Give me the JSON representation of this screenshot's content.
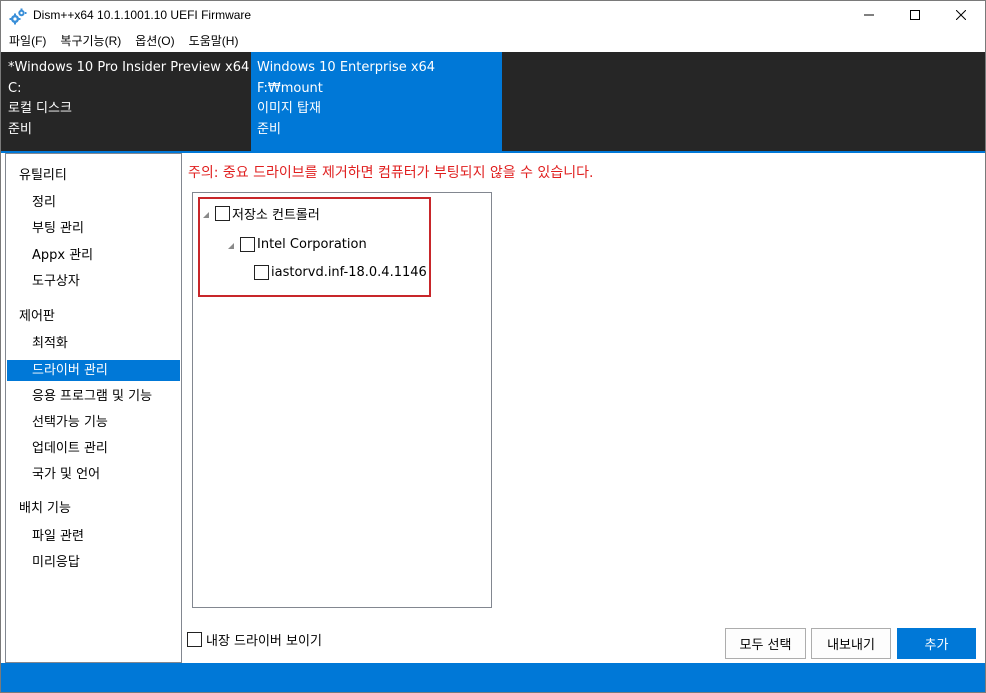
{
  "window": {
    "title": "Dism++x64 10.1.1001.10 UEFI Firmware",
    "icon": "gears-icon",
    "controls": [
      "minimize-icon",
      "maximize-icon",
      "close-icon"
    ]
  },
  "menu": {
    "items": [
      "파일(F)",
      "복구기능(R)",
      "옵션(O)",
      "도움말(H)"
    ]
  },
  "images": [
    {
      "name": "*Windows 10 Pro Insider Preview x64",
      "path": "C:",
      "type": "로컬 디스크",
      "status": "준비"
    },
    {
      "name": "Windows 10 Enterprise x64",
      "path": "F:₩mount",
      "type": "이미지 탑재",
      "status": "준비"
    }
  ],
  "sidebar": {
    "groups": [
      {
        "label": "유틸리티",
        "items": [
          "정리",
          "부팅 관리",
          "Appx 관리",
          "도구상자"
        ]
      },
      {
        "label": "제어판",
        "items": [
          "최적화",
          "드라이버 관리",
          "응용 프로그램 및 기능",
          "선택가능 기능",
          "업데이트 관리",
          "국가 및 언어"
        ]
      },
      {
        "label": "배치 기능",
        "items": [
          "파일 관련",
          "미리응답"
        ]
      }
    ],
    "selected": "드라이버 관리"
  },
  "main": {
    "warning": "주의: 중요 드라이브를 제거하면 컴퓨터가 부팅되지 않을 수 있습니다.",
    "tree": {
      "root": "저장소 컨트롤러",
      "vendor": "Intel Corporation",
      "driver": "iastorvd.inf-18.0.4.1146"
    },
    "show_builtin_label": "내장 드라이버 보이기",
    "buttons": {
      "select_all": "모두 선택",
      "export": "내보내기",
      "add": "추가"
    }
  },
  "colors": {
    "accent": "#0078d7",
    "warning": "#e02020",
    "highlight_border": "#c8262a",
    "header_dark": "#262626"
  }
}
